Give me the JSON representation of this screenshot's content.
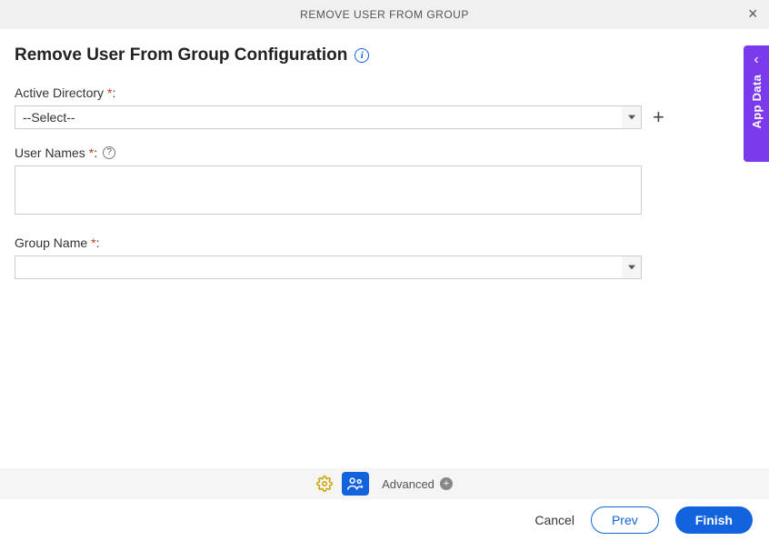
{
  "header": {
    "title": "REMOVE USER FROM GROUP"
  },
  "page": {
    "title": "Remove User From Group Configuration"
  },
  "fields": {
    "active_directory": {
      "label": "Active Directory",
      "required_mark": "*",
      "colon": ":",
      "value": "--Select--"
    },
    "user_names": {
      "label": "User Names",
      "required_mark": "*",
      "colon": ":",
      "value": "",
      "help": "?"
    },
    "group_name": {
      "label": "Group Name",
      "required_mark": "*",
      "colon": ":",
      "value": ""
    }
  },
  "bottom_bar": {
    "advanced_label": "Advanced"
  },
  "footer": {
    "cancel": "Cancel",
    "prev": "Prev",
    "finish": "Finish"
  },
  "side_tab": {
    "label": "App Data"
  }
}
